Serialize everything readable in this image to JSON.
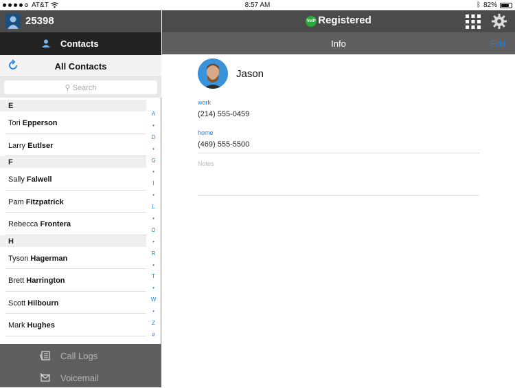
{
  "status_bar": {
    "carrier": "AT&T",
    "time": "8:57 AM",
    "battery": "82%",
    "battery_fraction": 0.82
  },
  "account": {
    "number": "25398"
  },
  "left_tabs": {
    "contacts_label": "Contacts"
  },
  "list": {
    "title": "All Contacts",
    "search_placeholder": "Search",
    "sections": [
      {
        "letter": "E",
        "contacts": [
          {
            "first": "Tori",
            "last": "Epperson"
          },
          {
            "first": "Larry",
            "last": "Eutlser"
          }
        ]
      },
      {
        "letter": "F",
        "contacts": [
          {
            "first": "Sally",
            "last": "Falwell"
          },
          {
            "first": "Pam",
            "last": "Fitzpatrick"
          },
          {
            "first": "Rebecca",
            "last": "Frontera"
          }
        ]
      },
      {
        "letter": "H",
        "contacts": [
          {
            "first": "Tyson",
            "last": "Hagerman"
          },
          {
            "first": "Brett",
            "last": "Harrington"
          },
          {
            "first": "Scott",
            "last": "Hilbourn"
          },
          {
            "first": "Mark",
            "last": "Hughes"
          }
        ]
      }
    ],
    "index": [
      "A",
      "•",
      "D",
      "•",
      "G",
      "•",
      "I",
      "•",
      "L",
      "•",
      "O",
      "•",
      "R",
      "•",
      "T",
      "•",
      "W",
      "•",
      "Z",
      "#"
    ]
  },
  "bottom_tabs": {
    "call_logs_label": "Call Logs",
    "voicemail_label": "Voicemail"
  },
  "header": {
    "status": "Registered",
    "voip_badge": "VoIP"
  },
  "info_bar": {
    "title": "Info",
    "edit_label": "Edit"
  },
  "contact": {
    "name": "Jason",
    "work_label": "work",
    "work_phone": "(214) 555-0459",
    "home_label": "home",
    "home_phone": "(469) 555-5500",
    "notes_placeholder": "Notes"
  },
  "colors": {
    "accent": "#1a7ee6",
    "bar_dark": "#4b4b4b",
    "tab_active": "#232323",
    "registered_green": "#29a93a"
  }
}
